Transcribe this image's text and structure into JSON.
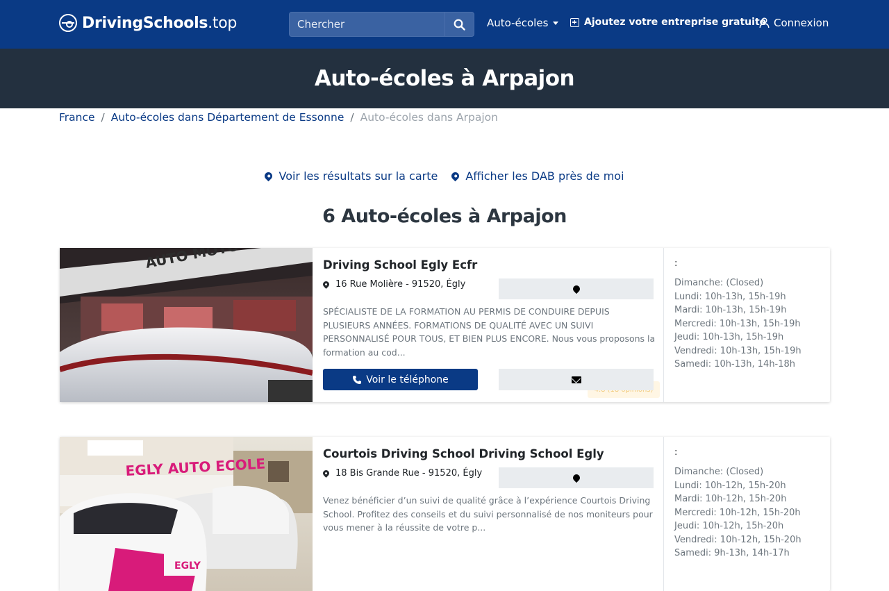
{
  "navbar": {
    "brand_bold": "DrivingSchools",
    "brand_light": ".top",
    "search_placeholder": "Chercher",
    "menu_auto": "Auto-écoles",
    "add_business": "Ajoutez votre entreprise gratuite",
    "login": "Connexion"
  },
  "hero": {
    "title": "Auto-écoles à Arpajon"
  },
  "breadcrumb": {
    "items": [
      "France",
      "Auto-écoles dans Département de Essonne",
      "Auto-écoles dans Arpajon"
    ],
    "separator": "/"
  },
  "map_links": {
    "map_results": "Voir les résultats sur la carte",
    "atm_near": "Afficher les DAB près de moi"
  },
  "results_title": "6 Auto-écoles à Arpajon",
  "listings": [
    {
      "name": "Driving School Egly Ecfr",
      "address": "16 Rue Molière - 91520, Égly",
      "description": "SPÉCIALISTE DE LA FORMATION AU PERMIS DE CONDUIRE DEPUIS PLUSIEURS ANNÉES. FORMATIONS DE QUALITÉ AVEC UN SUIVI PERSONNALISÉ POUR TOUS, ET BIEN PLUS ENCORE. Nous vous proposons la formation au cod...",
      "phone_label": "Voir le téléphone",
      "rating_text": "4.8 (18 opinions)",
      "hours_header": ":",
      "hours": [
        "Dimanche: (Closed)",
        "Lundi: 10h-13h, 15h-19h",
        "Mardi: 10h-13h, 15h-19h",
        "Mercredi: 10h-13h, 15h-19h",
        "Jeudi: 10h-13h, 15h-19h",
        "Vendredi: 10h-13h, 15h-19h",
        "Samedi: 10h-13h, 14h-18h"
      ],
      "photo_sign": "AUTO MOTO ECOLE"
    },
    {
      "name": "Courtois Driving School Driving School Egly",
      "address": "18 Bis Grande Rue - 91520, Égly",
      "description": "Venez bénéficier d’un suivi de qualité grâce à l’expérience Courtois Driving School. Profitez des conseils et du suivi personnalisé de nos moniteurs pour vous mener à la réussite de votre p...",
      "hours_header": ":",
      "hours": [
        "Dimanche: (Closed)",
        "Lundi: 10h-12h, 15h-20h",
        "Mardi: 10h-12h, 15h-20h",
        "Mercredi: 10h-12h, 15h-20h",
        "Jeudi: 10h-12h, 15h-20h",
        "Vendredi: 10h-12h, 15h-20h",
        "Samedi: 9h-13h, 14h-17h"
      ],
      "photo_sign": "EGLY AUTO ECOLE",
      "photo_car_text": "EGLY"
    }
  ],
  "colors": {
    "navbar_bg": "#0a3a85",
    "hero_bg": "#23303f",
    "link": "#0a3a85",
    "muted_text": "#6c757d"
  }
}
